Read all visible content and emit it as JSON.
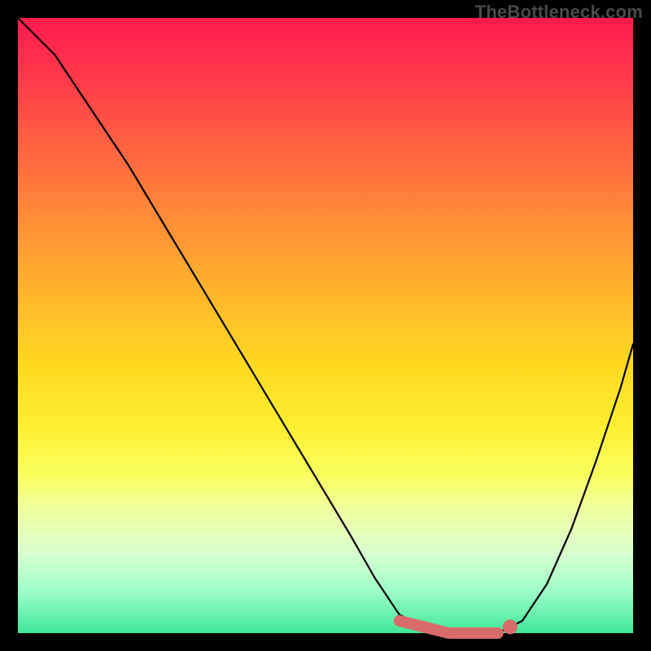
{
  "watermark": "TheBottleneck.com",
  "colors": {
    "frame": "#000000",
    "gradient_top": "#ff1a4f",
    "gradient_bottom": "#3fe89a",
    "curve": "#000000",
    "highlight": "#d96b6b"
  },
  "chart_data": {
    "type": "line",
    "title": "",
    "xlabel": "",
    "ylabel": "",
    "xlim": [
      0,
      100
    ],
    "ylim": [
      0,
      100
    ],
    "grid": false,
    "legend": false,
    "series": [
      {
        "name": "bottleneck-curve",
        "x": [
          0,
          6,
          12,
          18,
          24,
          30,
          36,
          42,
          48,
          54,
          58,
          62,
          66,
          70,
          74,
          78,
          82,
          86,
          90,
          94,
          98,
          100
        ],
        "values": [
          100,
          94,
          85,
          76,
          66,
          56,
          46,
          36,
          26,
          16,
          9,
          3,
          1,
          0,
          0,
          0,
          2,
          8,
          17,
          28,
          40,
          47
        ]
      }
    ],
    "highlight": {
      "name": "recommended-range",
      "x_start": 60,
      "x_end": 80,
      "y": 0,
      "dot_x": 80,
      "dot_y": 1
    }
  }
}
